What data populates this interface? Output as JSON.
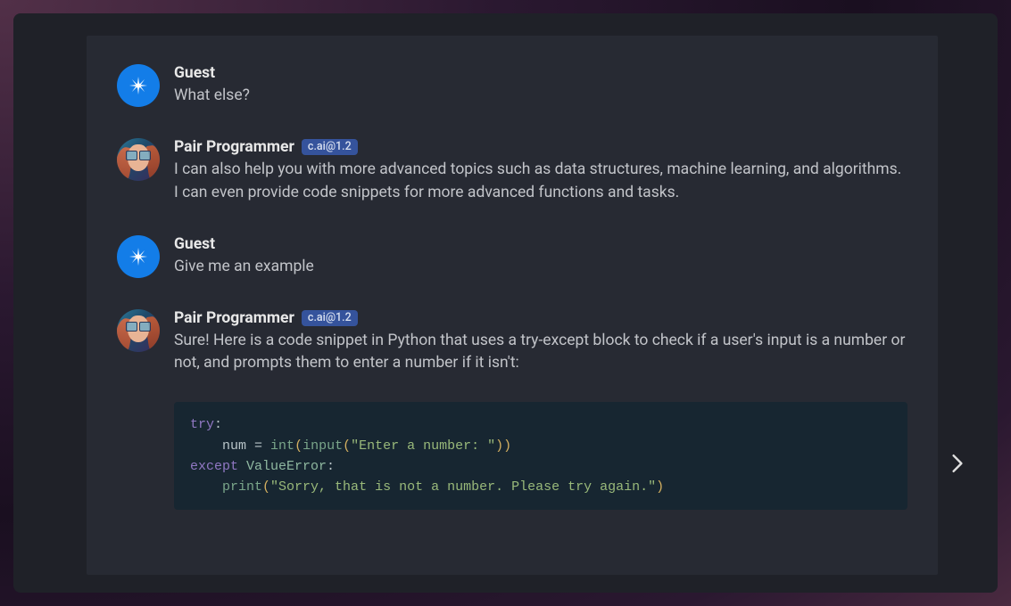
{
  "names": {
    "guest": "Guest",
    "bot": "Pair Programmer"
  },
  "badge": "c.ai@1.2",
  "messages": {
    "m1": {
      "text": "What else?"
    },
    "m2": {
      "text": "I can also help you with more advanced topics such as data structures, machine learning, and algorithms. I can even provide code snippets for more advanced functions and tasks."
    },
    "m3": {
      "text": "Give me an example"
    },
    "m4": {
      "text": "Sure! Here is a code snippet in Python that uses a try-except block to check if a user's input is a number or not, and prompts them to enter a number if it isn't:",
      "code": {
        "l1": {
          "kw": "try",
          "colon": ":"
        },
        "l2": {
          "indent": "    ",
          "var": "num ",
          "op": "= ",
          "fn": "int",
          "p1": "(",
          "fn2": "input",
          "p2": "(",
          "str": "\"Enter a number: \"",
          "p3": "))"
        },
        "l3": {
          "kw": "except",
          "sp": " ",
          "exc": "ValueError",
          "colon": ":"
        },
        "l4": {
          "indent": "    ",
          "fn": "print",
          "p1": "(",
          "str": "\"Sorry, that is not a number. Please try again.\"",
          "p2": ")"
        }
      }
    }
  }
}
